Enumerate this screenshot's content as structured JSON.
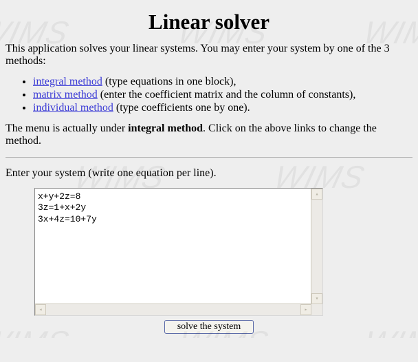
{
  "title": "Linear solver",
  "intro": "This application solves your linear systems. You may enter your system by one of the 3 methods:",
  "methods": [
    {
      "link": "integral method",
      "desc": " (type equations in one block),"
    },
    {
      "link": "matrix method",
      "desc": " (enter the coefficient matrix and the column of constants),"
    },
    {
      "link": "individual method",
      "desc": " (type coefficients one by one)."
    }
  ],
  "menu_line_pre": "The menu is actually under ",
  "menu_current": "integral method",
  "menu_line_post": ". Click on the above links to change the method.",
  "enter_prompt": "Enter your system (write one equation per line).",
  "system_text": "x+y+2z=8\n3z=1+x+2y\n3x+4z=10+7y",
  "solve_label": "solve the system",
  "watermark": "WIMS"
}
